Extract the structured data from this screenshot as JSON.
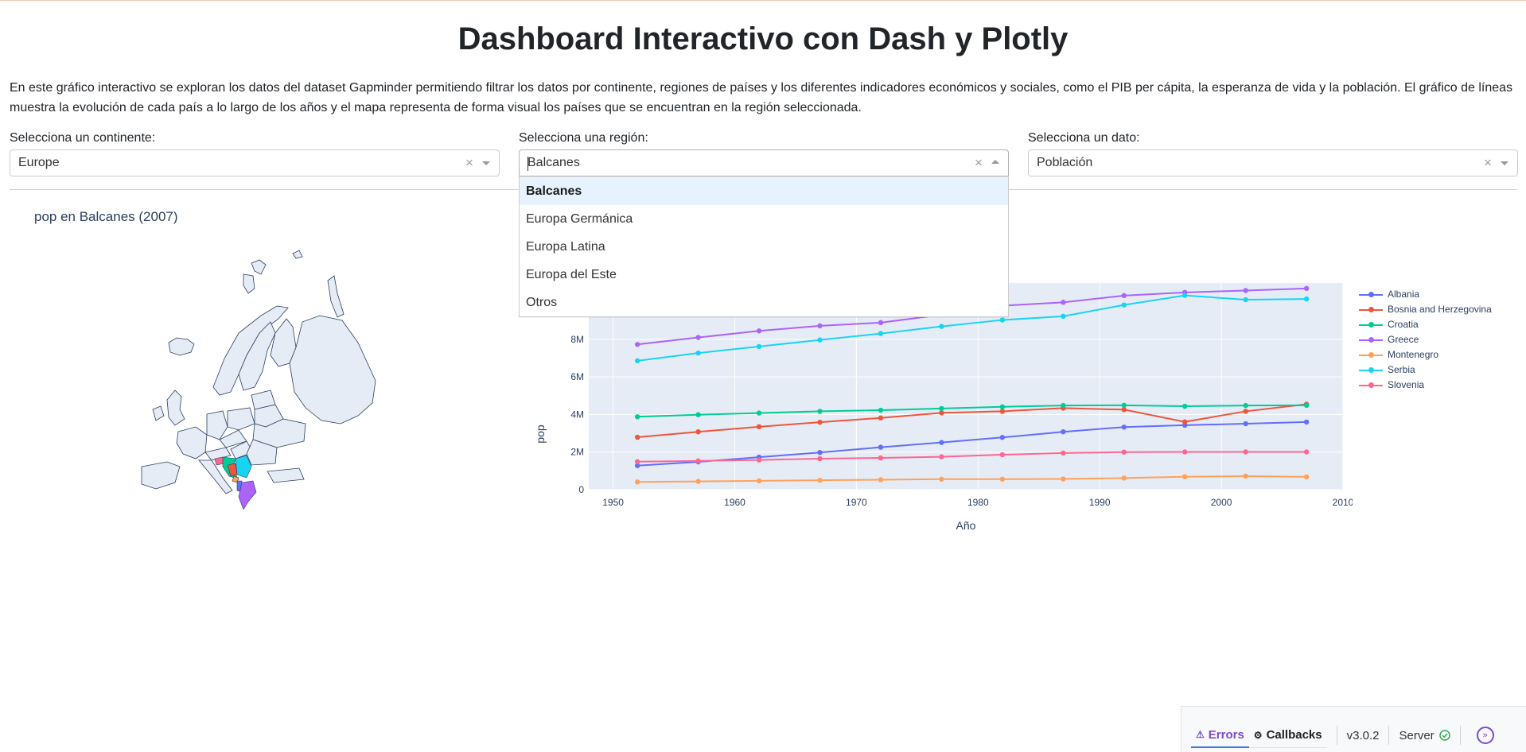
{
  "page": {
    "title": "Dashboard Interactivo con Dash y Plotly",
    "intro": "En este gráfico interactivo se exploran los datos del dataset Gapminder permitiendo filtrar los datos por continente, regiones de países y los diferentes indicadores económicos y sociales, como el PIB per cápita, la esperanza de vida y la población. El gráfico de líneas muestra la evolución de cada país a lo largo de los años y el mapa representa de forma visual los países que se encuentran en la región seleccionada."
  },
  "controls": {
    "continent": {
      "label": "Selecciona un continente:",
      "value": "Europe"
    },
    "region": {
      "label": "Selecciona una región:",
      "value": "Balcanes",
      "options": [
        "Balcanes",
        "Europa Germánica",
        "Europa Latina",
        "Europa del Este",
        "Otros"
      ],
      "selected_index": 0
    },
    "indicator": {
      "label": "Selecciona un dato:",
      "value": "Población"
    }
  },
  "map": {
    "title": "pop en Balcanes (2007)"
  },
  "chart_data": {
    "type": "line",
    "xlabel": "Año",
    "ylabel": "pop",
    "xlim": [
      1948,
      2010
    ],
    "ylim": [
      0,
      11000000
    ],
    "xticks": [
      1950,
      1960,
      1970,
      1980,
      1990,
      2000,
      2010
    ],
    "yticks": [
      0,
      2000000,
      4000000,
      6000000,
      8000000
    ],
    "ytick_labels": [
      "0",
      "2M",
      "4M",
      "6M",
      "8M"
    ],
    "x": [
      1952,
      1957,
      1962,
      1967,
      1972,
      1977,
      1982,
      1987,
      1992,
      1997,
      2002,
      2007
    ],
    "grid": true,
    "legend_position": "right",
    "series": [
      {
        "name": "Albania",
        "color": "#636efa",
        "values": [
          1280000,
          1480000,
          1730000,
          1980000,
          2260000,
          2510000,
          2780000,
          3080000,
          3330000,
          3430000,
          3510000,
          3600000
        ]
      },
      {
        "name": "Bosnia and Herzegovina",
        "color": "#ef553b",
        "values": [
          2790000,
          3080000,
          3350000,
          3590000,
          3820000,
          4090000,
          4170000,
          4340000,
          4260000,
          3610000,
          4170000,
          4550000
        ]
      },
      {
        "name": "Croatia",
        "color": "#00cc96",
        "values": [
          3880000,
          3990000,
          4080000,
          4170000,
          4230000,
          4320000,
          4410000,
          4480000,
          4490000,
          4440000,
          4480000,
          4490000
        ]
      },
      {
        "name": "Greece",
        "color": "#ab63fa",
        "values": [
          7730000,
          8100000,
          8450000,
          8720000,
          8890000,
          9310000,
          9790000,
          9970000,
          10330000,
          10500000,
          10600000,
          10710000
        ]
      },
      {
        "name": "Montenegro",
        "color": "#ffa15a",
        "values": [
          410000,
          440000,
          470000,
          500000,
          530000,
          560000,
          560000,
          570000,
          620000,
          690000,
          720000,
          680000
        ]
      },
      {
        "name": "Serbia",
        "color": "#19d3f3",
        "values": [
          6860000,
          7270000,
          7620000,
          7970000,
          8310000,
          8690000,
          9030000,
          9230000,
          9830000,
          10340000,
          10110000,
          10150000
        ]
      },
      {
        "name": "Slovenia",
        "color": "#ff6692",
        "values": [
          1490000,
          1530000,
          1580000,
          1650000,
          1690000,
          1750000,
          1860000,
          1950000,
          2000000,
          2010000,
          2010000,
          2010000
        ]
      }
    ]
  },
  "devtools": {
    "errors_label": "Errors",
    "callbacks_label": "Callbacks",
    "version": "v3.0.2",
    "server_label": "Server"
  }
}
